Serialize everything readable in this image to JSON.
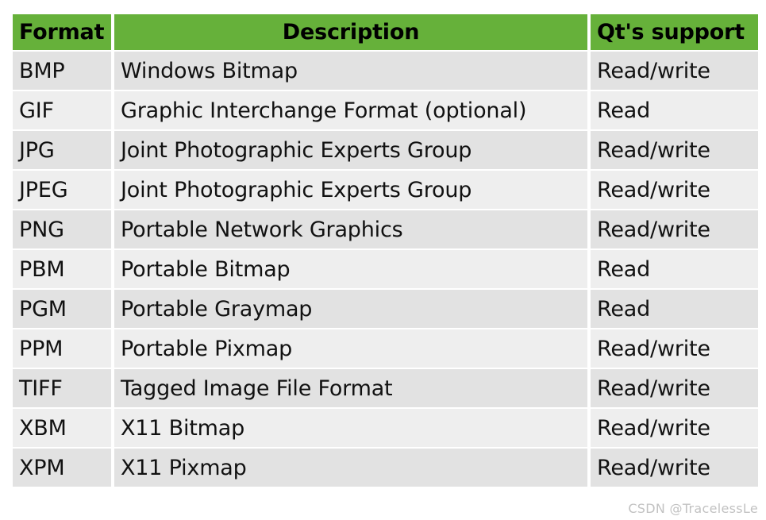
{
  "table": {
    "columns": [
      {
        "key": "format",
        "label": "Format",
        "align": "left"
      },
      {
        "key": "description",
        "label": "Description",
        "align": "center"
      },
      {
        "key": "support",
        "label": "Qt's support",
        "align": "left"
      }
    ],
    "rows": [
      {
        "format": "BMP",
        "description": "Windows Bitmap",
        "support": "Read/write"
      },
      {
        "format": "GIF",
        "description": "Graphic Interchange Format (optional)",
        "support": "Read"
      },
      {
        "format": "JPG",
        "description": "Joint Photographic Experts Group",
        "support": "Read/write"
      },
      {
        "format": "JPEG",
        "description": "Joint Photographic Experts Group",
        "support": "Read/write"
      },
      {
        "format": "PNG",
        "description": "Portable Network Graphics",
        "support": "Read/write"
      },
      {
        "format": "PBM",
        "description": "Portable Bitmap",
        "support": "Read"
      },
      {
        "format": "PGM",
        "description": "Portable Graymap",
        "support": "Read"
      },
      {
        "format": "PPM",
        "description": "Portable Pixmap",
        "support": "Read/write"
      },
      {
        "format": "TIFF",
        "description": "Tagged Image File Format",
        "support": "Read/write"
      },
      {
        "format": "XBM",
        "description": "X11 Bitmap",
        "support": "Read/write"
      },
      {
        "format": "XPM",
        "description": "X11 Pixmap",
        "support": "Read/write"
      }
    ]
  },
  "watermark": {
    "text": "CSDN @TracelessLe"
  },
  "colors": {
    "header_green": "#66b13a",
    "row_odd": "#e2e2e2",
    "row_even": "#eeeeee",
    "text": "#111111",
    "watermark": "#c2c2c2"
  }
}
